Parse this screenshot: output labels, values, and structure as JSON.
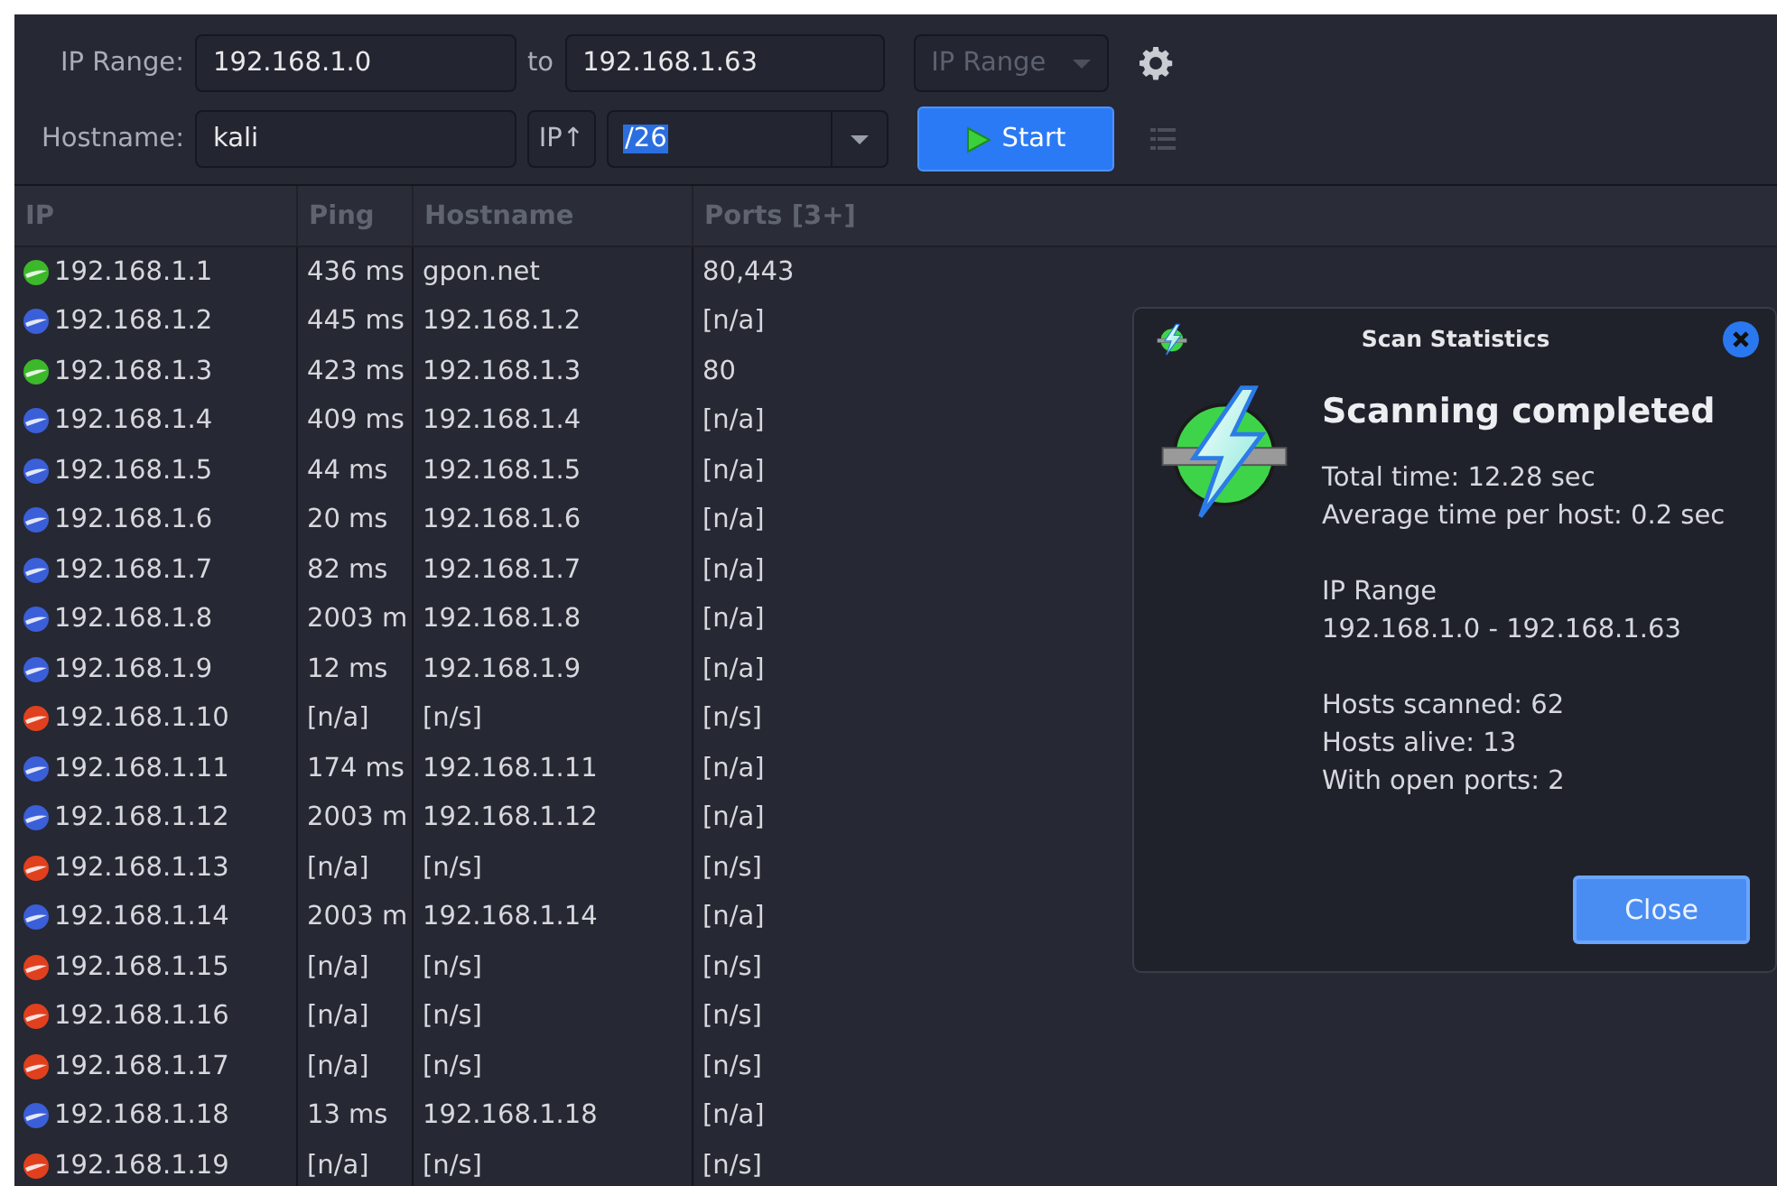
{
  "toolbar": {
    "range_label": "IP Range:",
    "range_from": "192.168.1.0",
    "to_label": "to",
    "range_to": "192.168.1.63",
    "feeder": {
      "label": "IP Range",
      "disabled": true
    },
    "hostname_label": "Hostname:",
    "hostname": "kali",
    "ip_button": "IP↑",
    "netmask": {
      "value": "/26",
      "highlighted": true
    },
    "start_button": "Start"
  },
  "table": {
    "columns": [
      "IP",
      "Ping",
      "Hostname",
      "Ports [3+]"
    ],
    "rows": [
      {
        "color": "#3cb82a",
        "ip": "192.168.1.1",
        "ping": "436 ms",
        "hostname": "gpon.net",
        "ports": "80,443"
      },
      {
        "color": "#3a5fd8",
        "ip": "192.168.1.2",
        "ping": "445 ms",
        "hostname": "192.168.1.2",
        "ports": "[n/a]"
      },
      {
        "color": "#3cb82a",
        "ip": "192.168.1.3",
        "ping": "423 ms",
        "hostname": "192.168.1.3",
        "ports": "80"
      },
      {
        "color": "#3a5fd8",
        "ip": "192.168.1.4",
        "ping": "409 ms",
        "hostname": "192.168.1.4",
        "ports": "[n/a]"
      },
      {
        "color": "#3a5fd8",
        "ip": "192.168.1.5",
        "ping": "44 ms",
        "hostname": "192.168.1.5",
        "ports": "[n/a]"
      },
      {
        "color": "#3a5fd8",
        "ip": "192.168.1.6",
        "ping": "20 ms",
        "hostname": "192.168.1.6",
        "ports": "[n/a]"
      },
      {
        "color": "#3a5fd8",
        "ip": "192.168.1.7",
        "ping": "82 ms",
        "hostname": "192.168.1.7",
        "ports": "[n/a]"
      },
      {
        "color": "#3a5fd8",
        "ip": "192.168.1.8",
        "ping": "2003 m",
        "hostname": "192.168.1.8",
        "ports": "[n/a]"
      },
      {
        "color": "#3a5fd8",
        "ip": "192.168.1.9",
        "ping": "12 ms",
        "hostname": "192.168.1.9",
        "ports": "[n/a]"
      },
      {
        "color": "#e0401e",
        "ip": "192.168.1.10",
        "ping": "[n/a]",
        "hostname": "[n/s]",
        "ports": "[n/s]"
      },
      {
        "color": "#3a5fd8",
        "ip": "192.168.1.11",
        "ping": "174 ms",
        "hostname": "192.168.1.11",
        "ports": "[n/a]"
      },
      {
        "color": "#3a5fd8",
        "ip": "192.168.1.12",
        "ping": "2003 m",
        "hostname": "192.168.1.12",
        "ports": "[n/a]"
      },
      {
        "color": "#e0401e",
        "ip": "192.168.1.13",
        "ping": "[n/a]",
        "hostname": "[n/s]",
        "ports": "[n/s]"
      },
      {
        "color": "#3a5fd8",
        "ip": "192.168.1.14",
        "ping": "2003 m",
        "hostname": "192.168.1.14",
        "ports": "[n/a]"
      },
      {
        "color": "#e0401e",
        "ip": "192.168.1.15",
        "ping": "[n/a]",
        "hostname": "[n/s]",
        "ports": "[n/s]"
      },
      {
        "color": "#e0401e",
        "ip": "192.168.1.16",
        "ping": "[n/a]",
        "hostname": "[n/s]",
        "ports": "[n/s]"
      },
      {
        "color": "#e0401e",
        "ip": "192.168.1.17",
        "ping": "[n/a]",
        "hostname": "[n/s]",
        "ports": "[n/s]"
      },
      {
        "color": "#3a5fd8",
        "ip": "192.168.1.18",
        "ping": "13 ms",
        "hostname": "192.168.1.18",
        "ports": "[n/a]"
      },
      {
        "color": "#e0401e",
        "ip": "192.168.1.19",
        "ping": "[n/a]",
        "hostname": "[n/s]",
        "ports": "[n/s]"
      }
    ]
  },
  "dialog": {
    "title": "Scan Statistics",
    "heading": "Scanning completed",
    "groups": [
      [
        "Total time: 12.28 sec",
        "Average time per host: 0.2 sec"
      ],
      [
        "IP Range",
        "192.168.1.0 - 192.168.1.63"
      ],
      [
        "Hosts scanned: 62",
        "Hosts alive: 13",
        "With open ports: 2"
      ]
    ],
    "close_button": "Close"
  }
}
